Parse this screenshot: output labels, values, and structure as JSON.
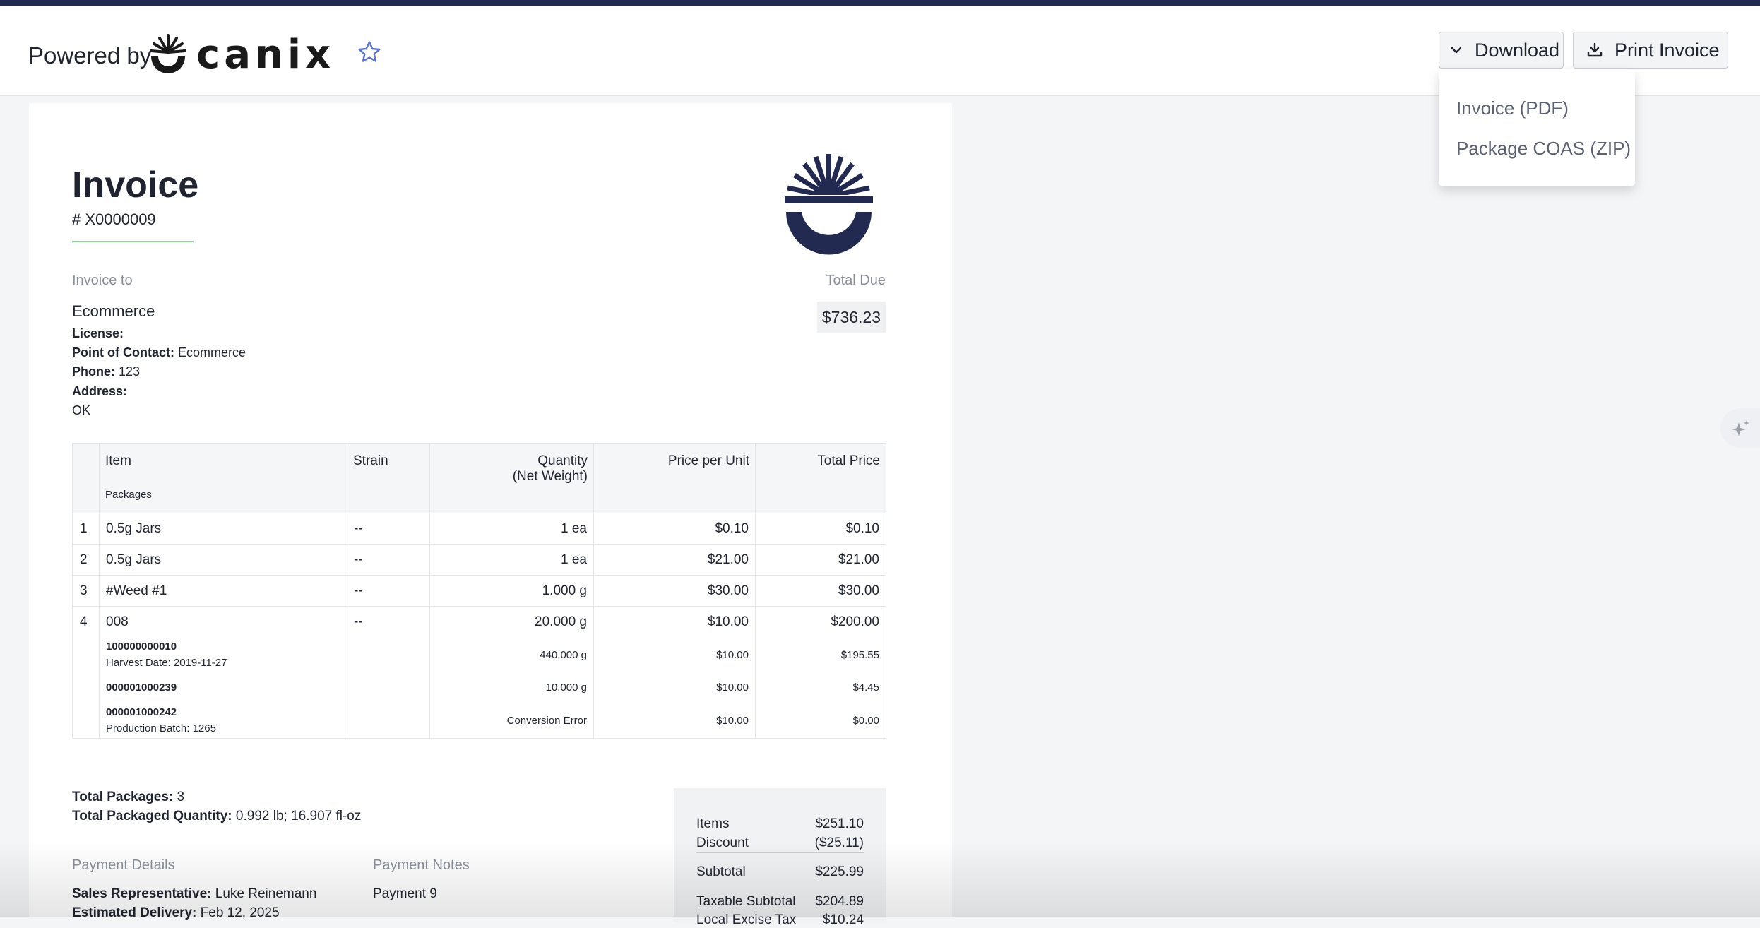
{
  "header": {
    "powered_by": "Powered by",
    "brand": "canix",
    "download_label": "Download",
    "print_label": "Print Invoice"
  },
  "download_menu": {
    "items": [
      "Invoice (PDF)",
      "Package COAS (ZIP)"
    ]
  },
  "invoice": {
    "title": "Invoice",
    "number": "# X0000009",
    "invoice_to_label": "Invoice to",
    "total_due_label": "Total Due",
    "total_due": "$736.23",
    "customer": {
      "name": "Ecommerce",
      "license_label": "License:",
      "license": "",
      "contact_label": "Point of Contact:",
      "contact": "Ecommerce",
      "phone_label": "Phone:",
      "phone": "123",
      "address_label": "Address:",
      "address": "OK"
    }
  },
  "table": {
    "headers": {
      "item": "Item",
      "packages": "Packages",
      "strain": "Strain",
      "quantity": "Quantity",
      "quantity_sub": "(Net Weight)",
      "price_per_unit": "Price per Unit",
      "total_price": "Total Price"
    },
    "rows": [
      {
        "num": "1",
        "item": "0.5g Jars",
        "strain": "--",
        "qty": "1 ea",
        "ppu": "$0.10",
        "total": "$0.10"
      },
      {
        "num": "2",
        "item": "0.5g Jars",
        "strain": "--",
        "qty": "1 ea",
        "ppu": "$21.00",
        "total": "$21.00"
      },
      {
        "num": "3",
        "item": "#Weed #1",
        "strain": "--",
        "qty": "1.000 g",
        "ppu": "$30.00",
        "total": "$30.00"
      },
      {
        "num": "4",
        "item": "008",
        "strain": "--",
        "qty": "20.000 g",
        "ppu": "$10.00",
        "total": "$200.00"
      }
    ],
    "packages": [
      {
        "id": "100000000010",
        "meta": "Harvest Date: 2019-11-27",
        "qty": "440.000 g",
        "ppu": "$10.00",
        "total": "$195.55"
      },
      {
        "id": "000001000239",
        "meta": "",
        "qty": "10.000 g",
        "ppu": "$10.00",
        "total": "$4.45"
      },
      {
        "id": "000001000242",
        "meta": "Production Batch: 1265",
        "qty": "Conversion Error",
        "ppu": "$10.00",
        "total": "$0.00"
      }
    ]
  },
  "totals": {
    "packages_label": "Total Packages:",
    "packages": "3",
    "qty_label": "Total Packaged Quantity:",
    "qty": "0.992 lb; 16.907 fl-oz"
  },
  "payment": {
    "details_label": "Payment Details",
    "notes_label": "Payment Notes",
    "sales_rep_label": "Sales Representative:",
    "sales_rep": "Luke Reinemann",
    "est_delivery_label": "Estimated Delivery:",
    "est_delivery": "Feb 12, 2025",
    "note": "Payment 9"
  },
  "summary": {
    "items_label": "Items",
    "items": "$251.10",
    "discount_label": "Discount",
    "discount": "($25.11)",
    "subtotal_label": "Subtotal",
    "subtotal": "$225.99",
    "taxable_label": "Taxable Subtotal",
    "taxable": "$204.89",
    "excise_label": "Local Excise Tax",
    "excise": "$10.24"
  },
  "colors": {
    "brand_navy": "#222a52",
    "accent_green": "#8fcf99",
    "star_blue": "#5a72c9"
  },
  "icons": [
    "chevron-down-icon",
    "download-icon",
    "star-icon",
    "sparkle-icon"
  ]
}
